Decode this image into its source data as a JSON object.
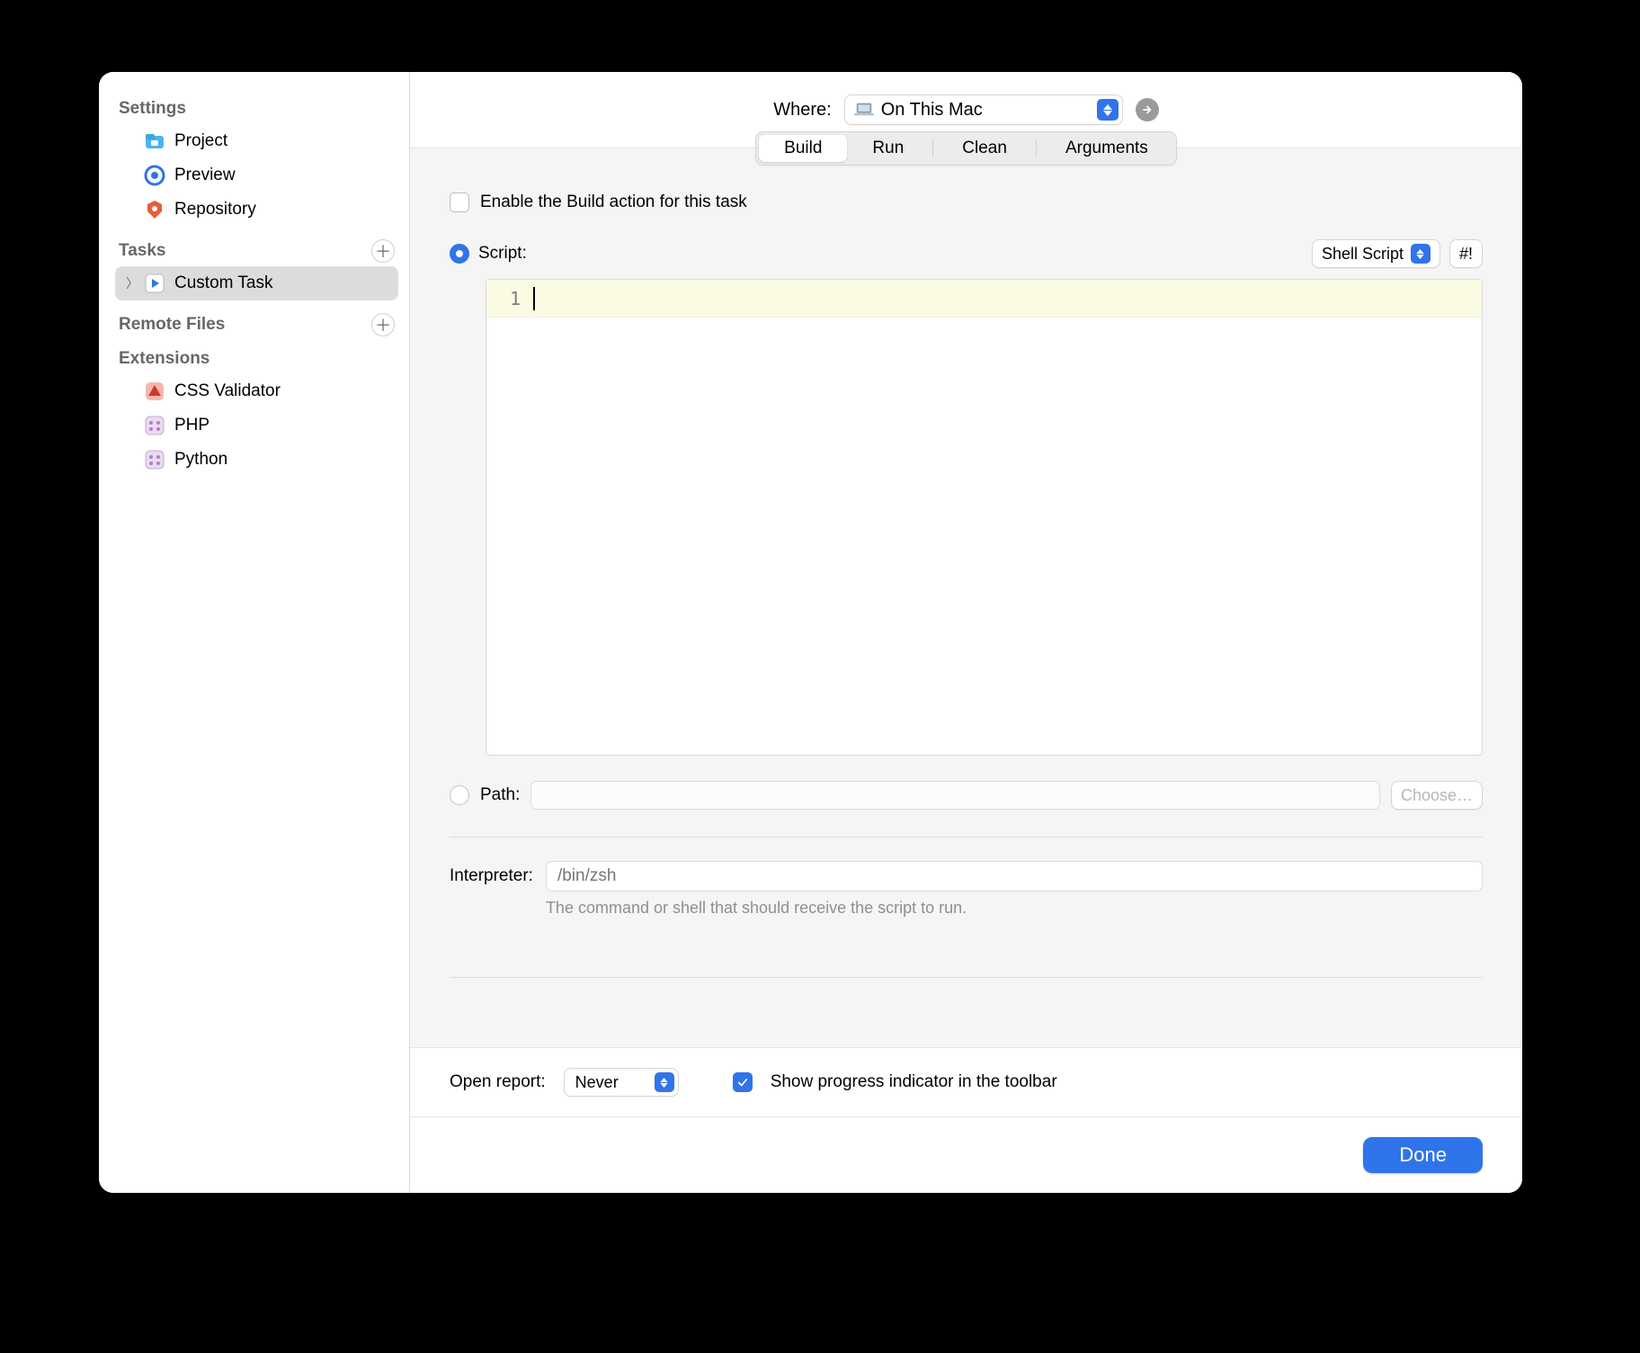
{
  "sidebar": {
    "settings_header": "Settings",
    "settings_items": [
      {
        "label": "Project"
      },
      {
        "label": "Preview"
      },
      {
        "label": "Repository"
      }
    ],
    "tasks_header": "Tasks",
    "tasks_items": [
      {
        "label": "Custom Task"
      }
    ],
    "remote_header": "Remote Files",
    "extensions_header": "Extensions",
    "extensions_items": [
      {
        "label": "CSS Validator"
      },
      {
        "label": "PHP"
      },
      {
        "label": "Python"
      }
    ]
  },
  "where": {
    "label": "Where:",
    "value": "On This Mac"
  },
  "tabs": {
    "items": [
      "Build",
      "Run",
      "Clean",
      "Arguments"
    ],
    "active": "Build"
  },
  "form": {
    "enable_label": "Enable the Build action for this task",
    "enable_checked": false,
    "script_label": "Script:",
    "script_type": "Shell Script",
    "shebang_button": "#!",
    "editor_line_number": "1",
    "path_label": "Path:",
    "choose_label": "Choose…",
    "interpreter_label": "Interpreter:",
    "interpreter_placeholder": "/bin/zsh",
    "interpreter_hint": "The command or shell that should receive the script to run."
  },
  "report": {
    "label": "Open report:",
    "value": "Never",
    "progress_label": "Show progress indicator in the toolbar",
    "progress_checked": true
  },
  "footer": {
    "done_label": "Done"
  }
}
